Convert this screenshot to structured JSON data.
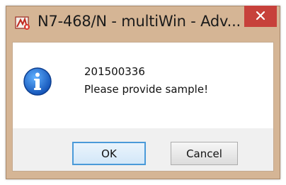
{
  "window": {
    "title": "N7-468/N - multiWin - Adv...",
    "icons": {
      "app": "multiwin-app-icon",
      "close": "close-icon"
    }
  },
  "dialog": {
    "icon": "info-icon",
    "line1": "201500336",
    "line2": "Please provide sample!"
  },
  "buttons": {
    "ok_label": "OK",
    "cancel_label": "Cancel"
  },
  "colors": {
    "frame": "#d5b595",
    "close": "#c7413b",
    "info_blue": "#1f6fc6",
    "default_button_border": "#4a9ad9"
  }
}
